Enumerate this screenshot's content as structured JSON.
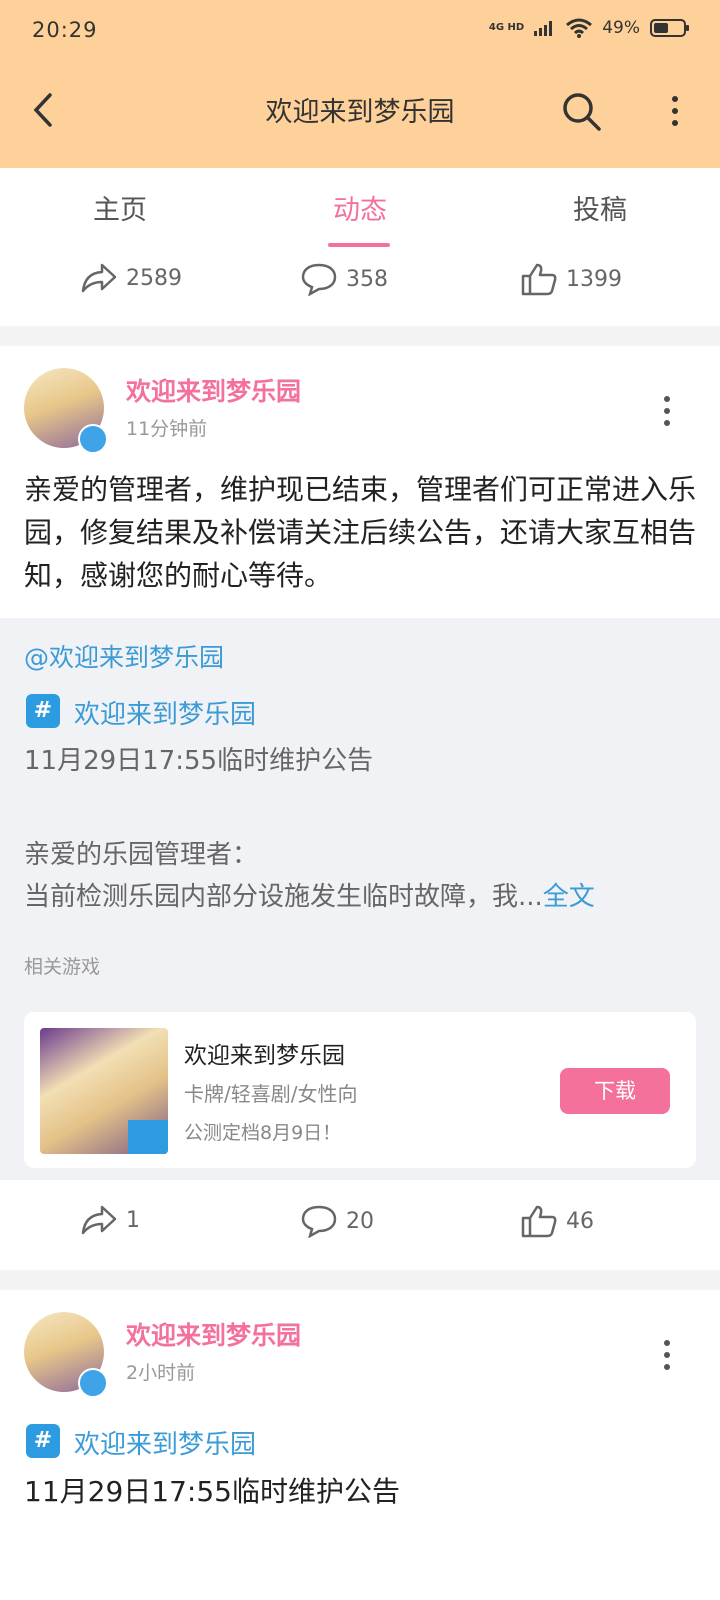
{
  "status_bar": {
    "time": "20:29",
    "network": "4G HD",
    "battery": "49%",
    "battery_level": 0.49
  },
  "header": {
    "title": "欢迎来到梦乐园",
    "back_icon": "back-arrow-icon",
    "search_icon": "search-icon",
    "more_icon": "more-vertical-icon"
  },
  "tabs": [
    {
      "label": "主页",
      "active": false
    },
    {
      "label": "动态",
      "active": true
    },
    {
      "label": "投稿",
      "active": false
    }
  ],
  "top_actions": {
    "share": "2589",
    "comment": "358",
    "like": "1399"
  },
  "post1": {
    "author": "欢迎来到梦乐园",
    "time": "11分钟前",
    "text": "亲爱的管理者，维护现已结束，管理者们可正常进入乐园，修复结果及补偿请关注后续公告，还请大家互相告知，感谢您的耐心等待。",
    "repost": {
      "mention": "@欢迎来到梦乐园",
      "topic": "欢迎来到梦乐园",
      "headline": "11月29日17:55临时维护公告",
      "greeting": "亲爱的乐园管理者：",
      "excerpt": "当前检测乐园内部分设施发生临时故障，我...",
      "full_text_link": "全文",
      "related_label": "相关游戏",
      "game": {
        "name": "欢迎来到梦乐园",
        "tags": "卡牌/轻喜剧/女性向",
        "subtitle": "公测定档8月9日！",
        "download_label": "下载"
      }
    },
    "actions": {
      "share": "1",
      "comment": "20",
      "like": "46"
    }
  },
  "post2": {
    "author": "欢迎来到梦乐园",
    "time": "2小时前",
    "topic": "欢迎来到梦乐园",
    "headline": "11月29日17:55临时维护公告"
  },
  "colors": {
    "header_bg": "#FFD19A",
    "accent_pink": "#F3719B",
    "link_blue": "#3A9BD6"
  }
}
